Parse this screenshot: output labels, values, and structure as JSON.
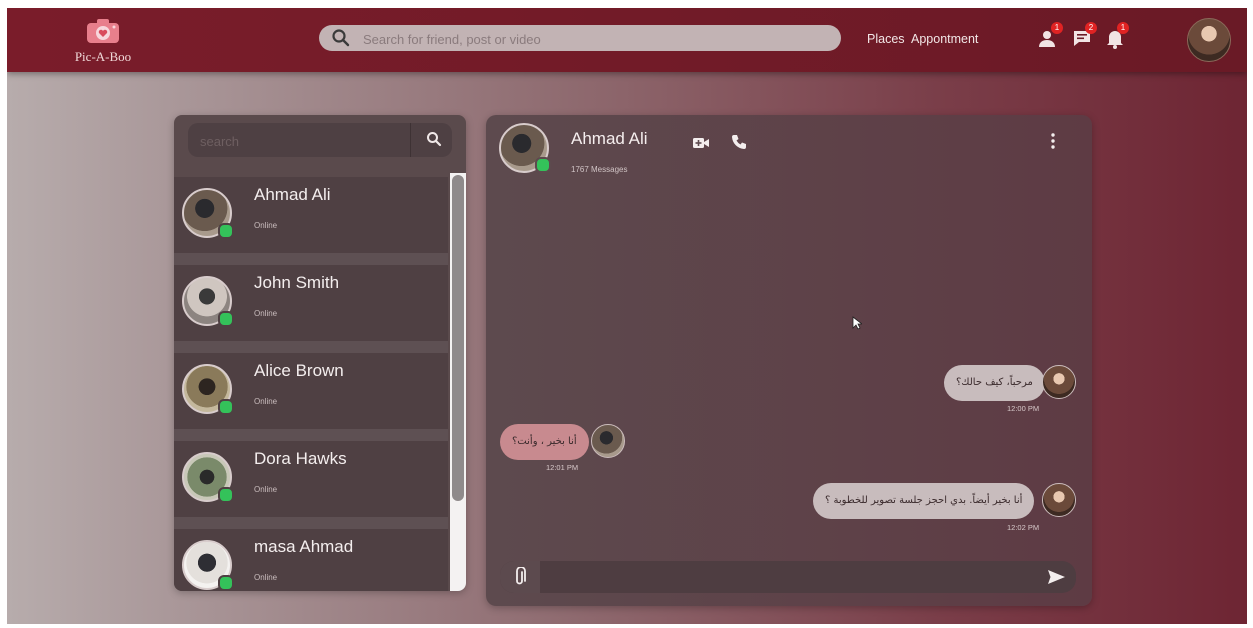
{
  "header": {
    "logo_text": "Pic-A-Boo",
    "search_placeholder": "Search for friend, post or video",
    "nav": [
      "Places",
      "Appontment"
    ],
    "badges": {
      "friends": "1",
      "messages": "2",
      "notifications": "1"
    }
  },
  "contacts": {
    "search_placeholder": "search",
    "items": [
      {
        "name": "Ahmad Ali",
        "status": "Online"
      },
      {
        "name": "John Smith",
        "status": "Online"
      },
      {
        "name": "Alice Brown",
        "status": "Online"
      },
      {
        "name": "Dora Hawks",
        "status": "Online"
      },
      {
        "name": "masa Ahmad",
        "status": "Online"
      }
    ]
  },
  "chat": {
    "name": "Ahmad Ali",
    "message_count": "1767 Messages",
    "messages": [
      {
        "side": "out",
        "text": "مرحباً، كيف حالك؟",
        "time": "12:00 PM"
      },
      {
        "side": "in",
        "text": "أنا بخير ، وأنت؟",
        "time": "12:01 PM"
      },
      {
        "side": "out",
        "text": "أنا بخير أيضاً. بدي احجز جلسة تصوير للخطوبة ؟",
        "time": "12:02 PM"
      }
    ]
  },
  "colors": {
    "topbar": "#7a1c2a",
    "online": "#34c25a",
    "badge": "#e02323"
  }
}
